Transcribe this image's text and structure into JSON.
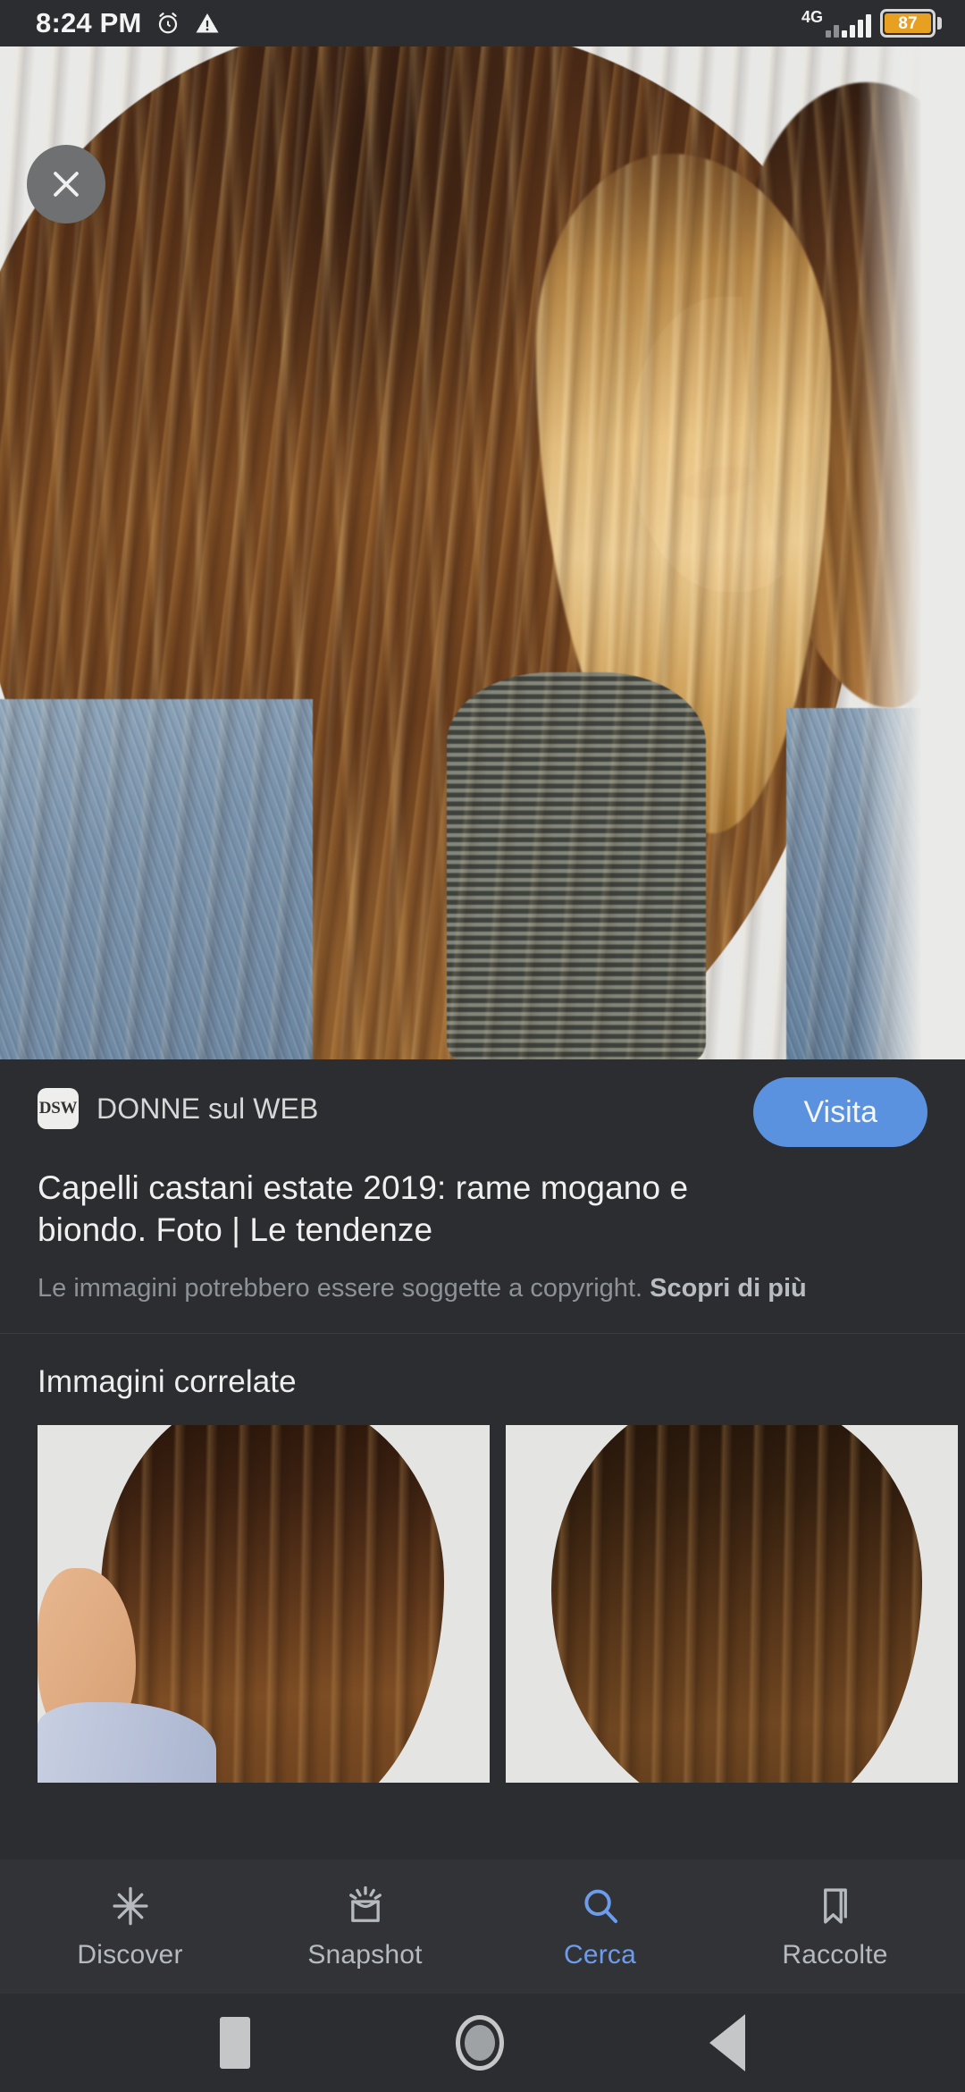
{
  "status_bar": {
    "time": "8:24 PM",
    "alarm_icon": "alarm-clock-icon",
    "warning_icon": "warning-triangle-icon",
    "network_label": "4G",
    "signal_icon": "signal-bars-icon",
    "battery_percent": "87",
    "battery_color": "#e8a020"
  },
  "hero": {
    "close_label": "close-icon",
    "image_alt": "Capelli castani estate 2019 hair photo"
  },
  "info": {
    "favicon_text": "DSW",
    "source_name": "DONNE sul WEB",
    "visit_label": "Visita",
    "title": "Capelli castani estate 2019: rame mogano e biondo. Foto | Le tendenze",
    "copyright_text": "Le immagini potrebbero essere soggette a copyright. ",
    "copyright_link": "Scopri di più",
    "accent_color": "#5b92e0"
  },
  "related": {
    "heading": "Immagini correlate",
    "thumbnails": [
      {
        "alt": "Capelli castani con balayage, vista posteriore"
      },
      {
        "alt": "Capelli castani ondulati con riflessi caramello"
      }
    ]
  },
  "bottom_nav": {
    "items": [
      {
        "label": "Discover",
        "icon": "sparkle-asterisk-icon",
        "active": false
      },
      {
        "label": "Snapshot",
        "icon": "snapshot-lens-icon",
        "active": false
      },
      {
        "label": "Cerca",
        "icon": "search-icon",
        "active": true
      },
      {
        "label": "Raccolte",
        "icon": "bookmark-icon",
        "active": false
      }
    ],
    "active_color": "#6c9ceb",
    "inactive_color": "#b6b9bd"
  },
  "android_nav": {
    "recents": "recents-square-icon",
    "home": "home-circle-icon",
    "back": "back-triangle-icon"
  }
}
